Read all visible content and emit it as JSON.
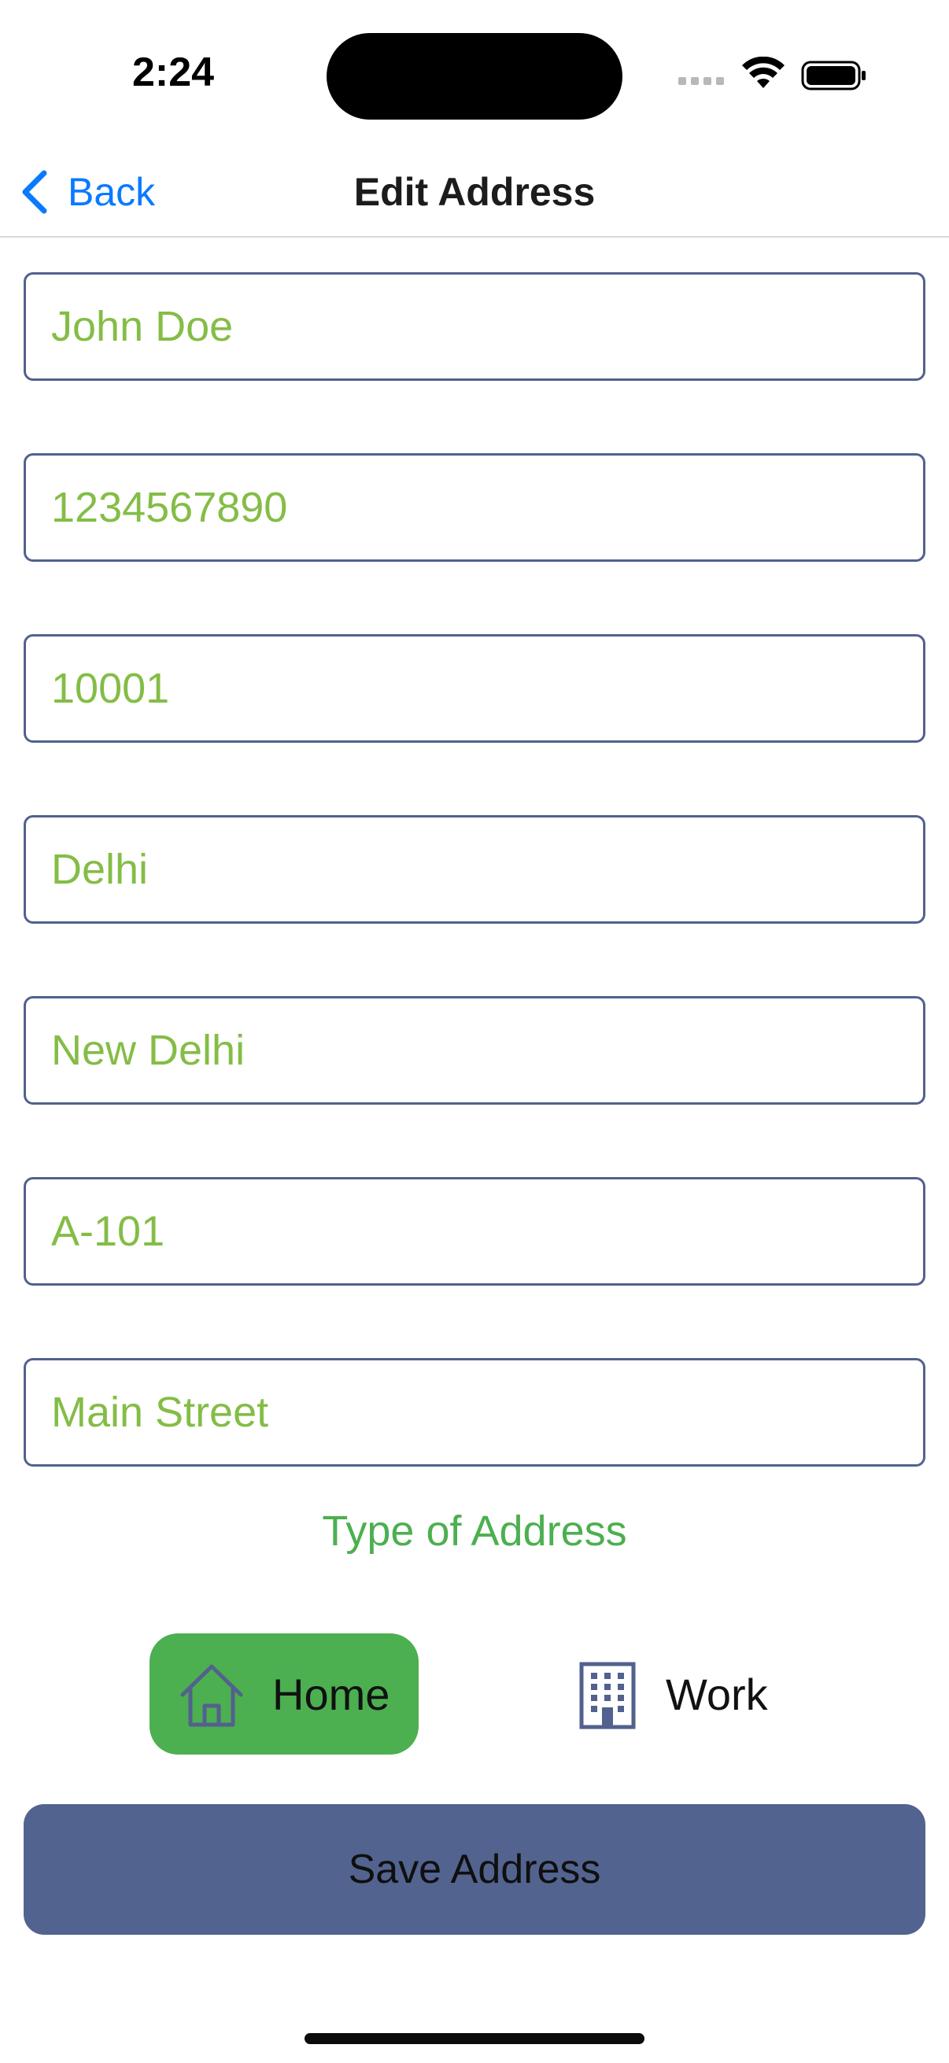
{
  "status_bar": {
    "time": "2:24"
  },
  "nav": {
    "back_label": "Back",
    "title": "Edit Address"
  },
  "form": {
    "fields": [
      {
        "name": "full-name-field",
        "value": "John Doe"
      },
      {
        "name": "phone-field",
        "value": "1234567890"
      },
      {
        "name": "pincode-field",
        "value": "10001"
      },
      {
        "name": "state-field",
        "value": "Delhi"
      },
      {
        "name": "city-field",
        "value": "New Delhi"
      },
      {
        "name": "house-number-field",
        "value": "A-101"
      },
      {
        "name": "street-field",
        "value": "Main Street"
      }
    ],
    "type_label": "Type of Address",
    "types": [
      {
        "label": "Home",
        "icon": "home-icon",
        "selected": true
      },
      {
        "label": "Work",
        "icon": "building-icon",
        "selected": false
      }
    ],
    "save_label": "Save Address"
  },
  "colors": {
    "accent_blue": "#0a7aff",
    "field_border": "#52618d",
    "field_text": "#84bd46",
    "selected_green": "#4caf50",
    "save_button": "#52638f"
  }
}
